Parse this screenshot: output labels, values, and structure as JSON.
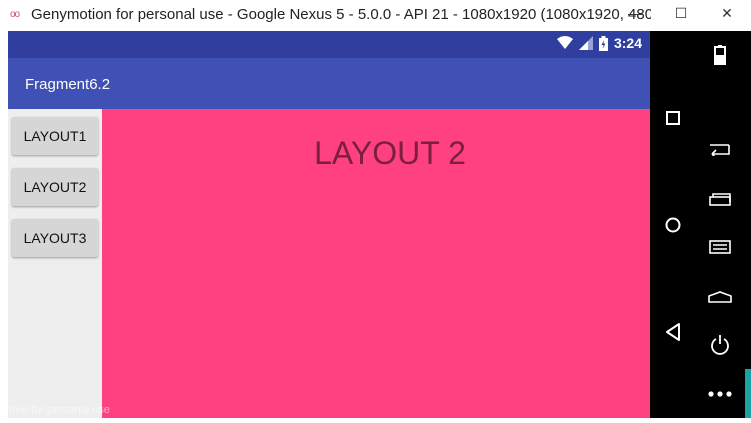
{
  "window": {
    "title": "Genymotion for personal use - Google Nexus 5 - 5.0.0 - API 21 - 1080x1920 (1080x1920, 480...",
    "app_icon": "oo",
    "min_label": "—",
    "max_label": "☐",
    "close_label": "✕"
  },
  "statusbar": {
    "time": "3:24",
    "icons": [
      "wifi-icon",
      "signal-icon",
      "battery-icon"
    ]
  },
  "appbar": {
    "title": "Fragment6.2"
  },
  "buttons": [
    {
      "label": "LAYOUT1"
    },
    {
      "label": "LAYOUT2"
    },
    {
      "label": "LAYOUT3"
    }
  ],
  "content": {
    "title": "LAYOUT 2",
    "background": "#ff4081"
  },
  "watermark": "free for personal use",
  "colors": {
    "statusbar": "#303f9f",
    "appbar": "#3f51b5",
    "accent": "#ff4081"
  },
  "navbar": {
    "icons": [
      "recents-icon",
      "home-icon",
      "back-icon"
    ]
  },
  "sidebar": {
    "icons": [
      "battery-icon",
      "back-icon",
      "recent-apps-icon",
      "menu-icon",
      "home-icon",
      "power-icon",
      "more-icon"
    ]
  }
}
